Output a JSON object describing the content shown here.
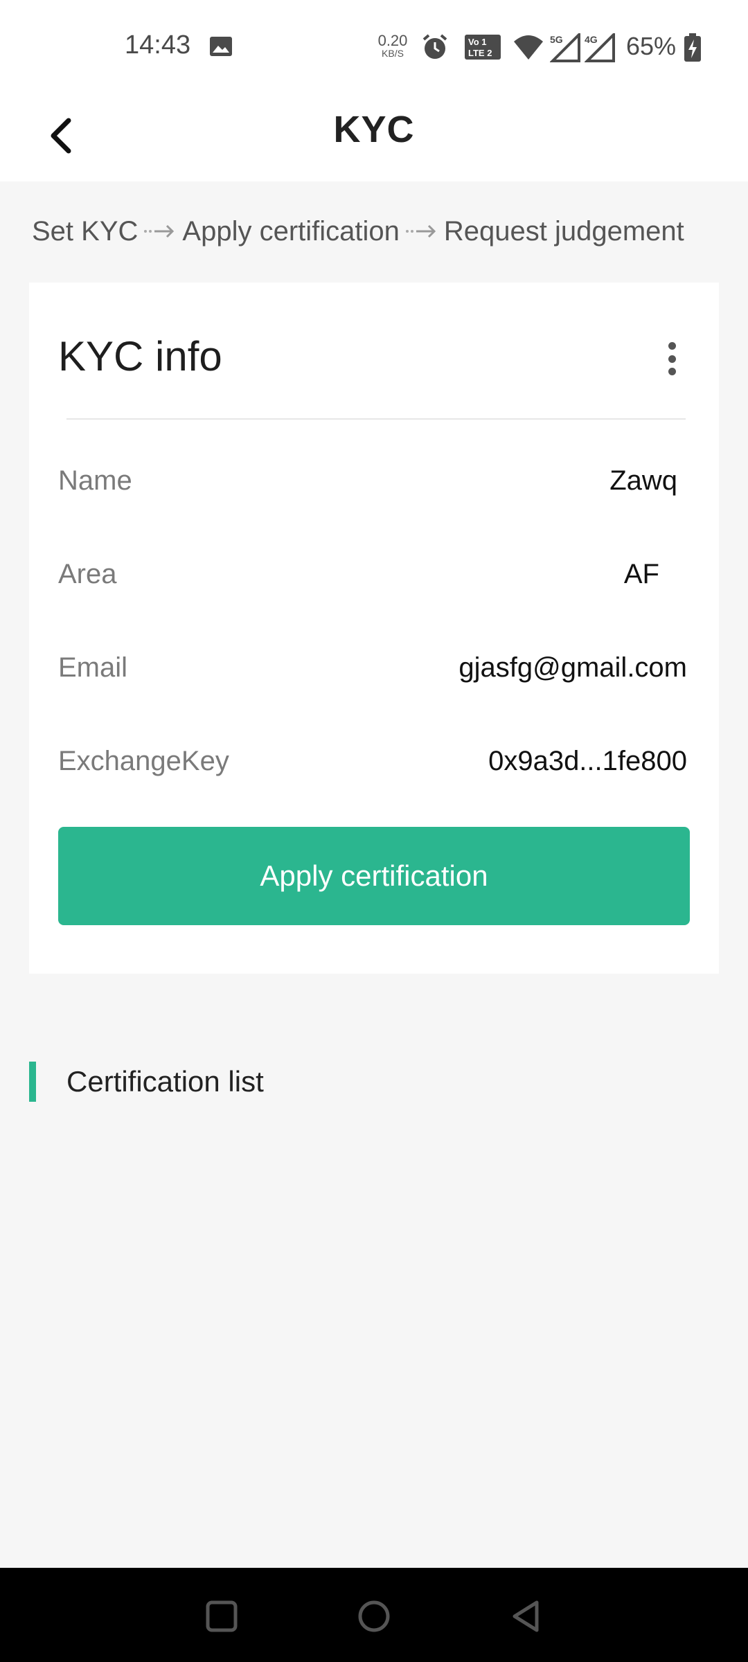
{
  "status_bar": {
    "time": "14:43",
    "net_speed_value": "0.20",
    "net_speed_unit": "KB/S",
    "battery": "65%",
    "icons": [
      "gallery-icon",
      "alarm-icon",
      "volte-icon",
      "wifi-icon",
      "signal-5g-icon",
      "signal-4g-icon",
      "battery-charging-icon"
    ]
  },
  "header": {
    "title": "KYC",
    "back_icon": "chevron-left-icon"
  },
  "steps": {
    "items": [
      "Set KYC",
      "Apply certification",
      "Request judgement"
    ]
  },
  "kyc_card": {
    "title": "KYC info",
    "menu_icon": "more-vertical-icon",
    "fields": [
      {
        "label": "Name",
        "value": "Zawq"
      },
      {
        "label": "Area",
        "value": "AF"
      },
      {
        "label": "Email",
        "value": "gjasfg@gmail.com"
      },
      {
        "label": "ExchangeKey",
        "value": "0x9a3d...1fe800"
      }
    ],
    "button_label": "Apply certification"
  },
  "certification_section": {
    "title": "Certification list"
  },
  "colors": {
    "accent": "#2bb68f",
    "background": "#f6f6f6",
    "card": "#ffffff",
    "nav_bar": "#000000"
  },
  "nav_bar": {
    "icons": [
      "recent-apps-icon",
      "home-icon",
      "back-icon"
    ]
  }
}
